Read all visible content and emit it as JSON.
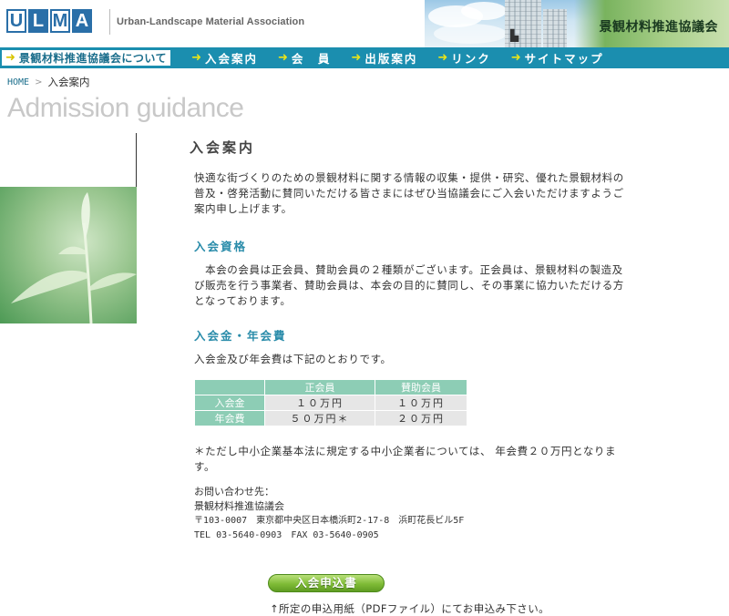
{
  "header": {
    "logo_letters": [
      "U",
      "L",
      "M",
      "A"
    ],
    "logo_subtitle": "Urban-Landscape Material Association",
    "site_title": "景観材料推進協議会"
  },
  "nav": {
    "arrow": "➜",
    "items": [
      {
        "label": "景観材料推進協議会について",
        "active": true
      },
      {
        "label": "入会案内",
        "active": false
      },
      {
        "label": "会　員",
        "active": false
      },
      {
        "label": "出版案内",
        "active": false
      },
      {
        "label": "リンク",
        "active": false
      },
      {
        "label": "サイトマップ",
        "active": false
      }
    ]
  },
  "breadcrumb": {
    "home": "HOME",
    "separator": ">",
    "current": "入会案内"
  },
  "page": {
    "heading_en": "Admission guidance",
    "section_title": "入会案内",
    "intro_lines": [
      "快適な街づくりのための景観材料に関する情報の収集・提供・研究、優れた景観材料の",
      "普及・啓発活動に賛同いただける皆さまにはぜひ当協議会にご入会いただけますようご",
      "案内申し上げます。"
    ],
    "qualification": {
      "title": "入会資格",
      "lines": [
        "　本会の会員は正会員、賛助会員の２種類がございます。正会員は、景観材料の製造及",
        "び販売を行う事業者、賛助会員は、本会の目的に賛同し、その事業に協力いただける方",
        "となっております。"
      ]
    },
    "fees": {
      "title": "入会金・年会費",
      "intro": "入会金及び年会費は下記のとおりです。",
      "columns": [
        "正会員",
        "賛助会員"
      ],
      "rows": [
        {
          "label": "入会金",
          "values": [
            "１０万円",
            "１０万円"
          ]
        },
        {
          "label": "年会費",
          "values": [
            "５０万円＊",
            "２０万円"
          ]
        }
      ],
      "note_lines": [
        "＊ただし中小企業基本法に規定する中小企業者については、 年会費２０万円となりま",
        "す。"
      ]
    },
    "contact": {
      "label": "お問い合わせ先：",
      "org": "景観材料推進協議会",
      "address": "〒103-0007　東京都中央区日本橋浜町2-17-8　浜町花長ビル5F",
      "phone": "TEL 03-5640-0903　FAX 03-5640-0905"
    },
    "apply": {
      "button_label": "入会申込書",
      "note": "↑所定の申込用紙（PDFファイル）にてお申込み下さい。"
    }
  }
}
